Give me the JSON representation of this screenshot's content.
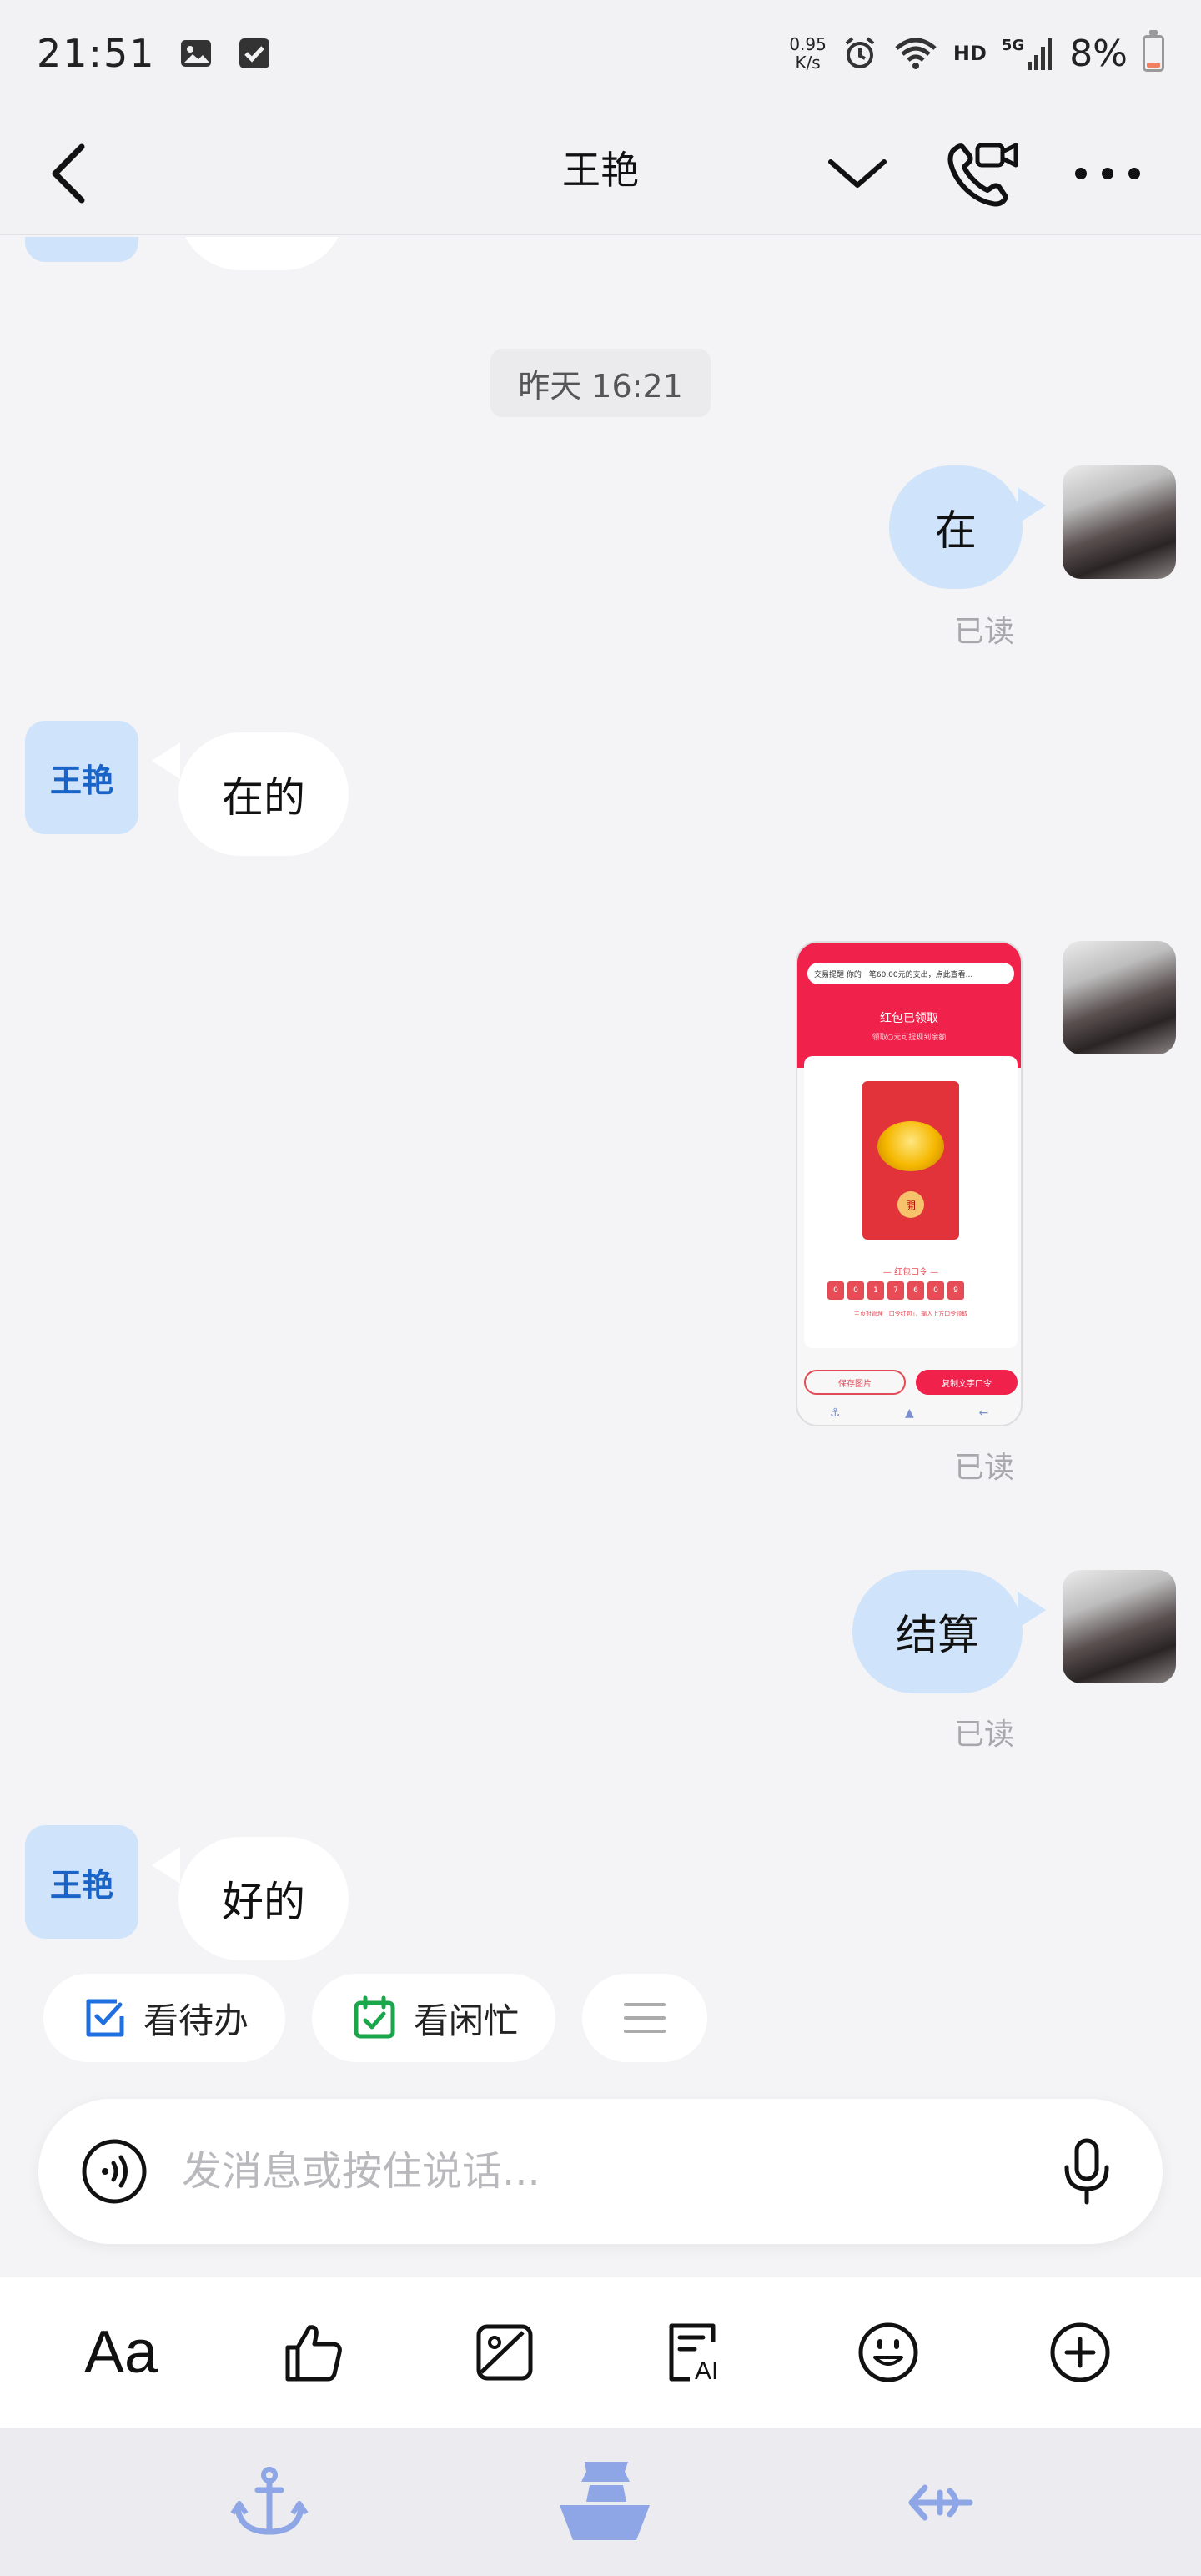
{
  "status_bar": {
    "time": "21:51",
    "net_speed_value": "0.95",
    "net_speed_unit": "K/s",
    "hd": "HD",
    "signal": "5G",
    "battery": "8%"
  },
  "header": {
    "title": "王艳"
  },
  "messages": {
    "timestamp": "昨天 16:21",
    "m1_text": "在",
    "m1_status": "已读",
    "m2_avatar": "王艳",
    "m2_text": "在的",
    "m3_status": "已读",
    "m4_text": "结算",
    "m4_status": "已读",
    "m5_avatar": "王艳",
    "m5_text": "好的"
  },
  "thumbnail": {
    "notice": "交易提醒 你的一笔60.00元的支出，点此查看...",
    "title": "红包已领取",
    "subtitle": "领取○元可提现到余额",
    "code_label": "— 红包口令 —",
    "codes": [
      "0",
      "0",
      "1",
      "7",
      "6",
      "0",
      "9"
    ],
    "note": "主页对管理「口令红包」，输入上方口令领取",
    "save_btn": "保存图片",
    "copy_btn": "复制文字口令",
    "seal": "開"
  },
  "chips": [
    {
      "label": "看待办",
      "color": "#1f6fe0"
    },
    {
      "label": "看闲忙",
      "color": "#1aa64b"
    }
  ],
  "input": {
    "placeholder": "发消息或按住说话..."
  },
  "toolbar": {
    "font_label": "Aa"
  },
  "colors": {
    "accent": "#1a63c7",
    "bubble_out": "#cfe3fb",
    "nav": "#8ea6e6"
  }
}
